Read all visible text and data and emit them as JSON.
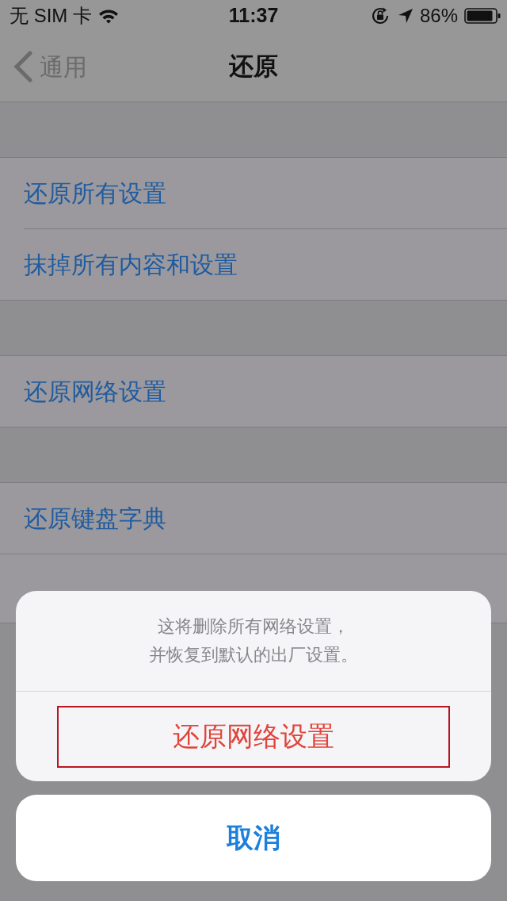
{
  "status_bar": {
    "carrier": "无 SIM 卡",
    "time": "11:37",
    "battery": "86%"
  },
  "nav_bar": {
    "back": "通用",
    "title": "还原"
  },
  "groups": [
    {
      "items": [
        {
          "label": "还原所有设置"
        },
        {
          "label": "抹掉所有内容和设置"
        }
      ]
    },
    {
      "items": [
        {
          "label": "还原网络设置"
        }
      ]
    },
    {
      "items": [
        {
          "label": "还原键盘字典"
        }
      ]
    }
  ],
  "action_sheet": {
    "message_lines": [
      "这将删除所有网络设置，",
      "并恢复到默认的出厂设置。"
    ],
    "actions": [
      {
        "label": "还原网络设置",
        "kind": "destructive",
        "highlighted": true
      }
    ],
    "cancel": "取消"
  }
}
